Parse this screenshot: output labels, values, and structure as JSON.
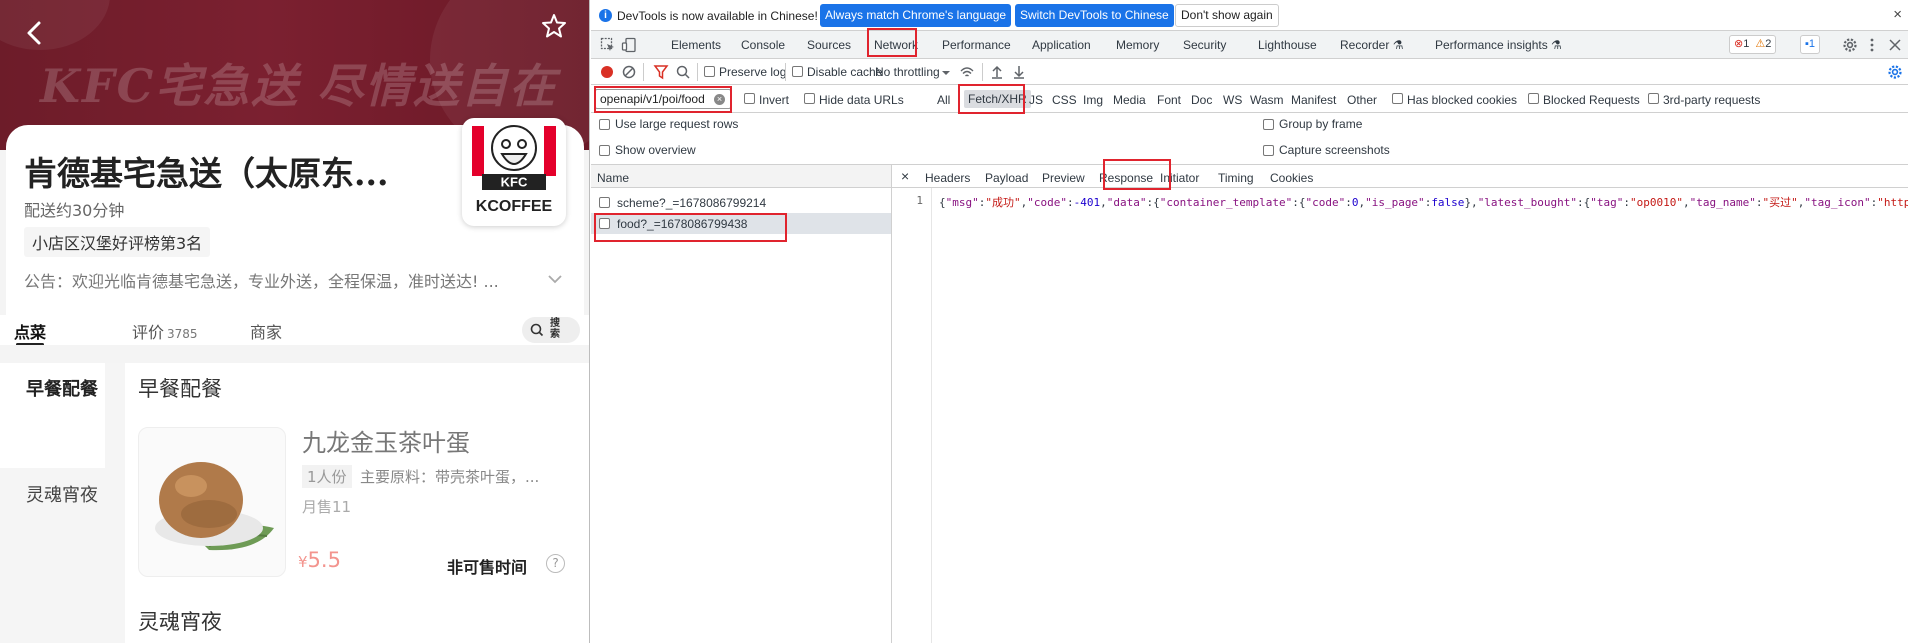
{
  "app": {
    "banner_text": "KFC宅急送 尽情送自在",
    "shop_name": "肯德基宅急送（太原东...",
    "delivery_time": "配送约30分钟",
    "rank_badge": "小店区汉堡好评榜第3名",
    "notice": "公告：欢迎光临肯德基宅急送，专业外送，全程保温，准时送达! ...",
    "logo_top": "KFC",
    "logo_bottom": "KCOFFEE",
    "tabs": {
      "order": "点菜",
      "review": "评价",
      "review_count": "3785",
      "shop": "商家",
      "search": "搜索"
    },
    "categories": [
      "早餐配餐",
      "灵魂宵夜"
    ],
    "sections": [
      "早餐配餐",
      "灵魂宵夜"
    ],
    "item": {
      "name": "九龙金玉茶叶蛋",
      "portion": "1人份",
      "desc": "主要原料：带壳茶叶蛋，...",
      "sales": "月售11",
      "price_currency": "¥",
      "price": "5.5",
      "status": "非可售时间",
      "help": "?"
    }
  },
  "devtools": {
    "infobar": {
      "message": "DevTools is now available in Chinese!",
      "match_button": "Always match Chrome's language",
      "switch_button": "Switch DevTools to Chinese",
      "dismiss_button": "Don't show again",
      "close": "×"
    },
    "tabs": [
      "Elements",
      "Console",
      "Sources",
      "Network",
      "Performance",
      "Application",
      "Memory",
      "Security",
      "Lighthouse",
      "Recorder ⚗",
      "Performance insights ⚗"
    ],
    "badges": {
      "errors": "1",
      "warnings": "2",
      "messages": "1"
    },
    "toolbar": {
      "preserve_log": "Preserve log",
      "disable_cache": "Disable cache",
      "throttling": "No throttling"
    },
    "filter": {
      "value": "openapi/v1/poi/food",
      "invert": "Invert",
      "hide_data_urls": "Hide data URLs",
      "types": [
        "All",
        "Fetch/XHR",
        "JS",
        "CSS",
        "Img",
        "Media",
        "Font",
        "Doc",
        "WS",
        "Wasm",
        "Manifest",
        "Other"
      ],
      "has_blocked_cookies": "Has blocked cookies",
      "blocked_requests": "Blocked Requests",
      "third_party": "3rd-party requests"
    },
    "options": {
      "large_rows": "Use large request rows",
      "overview": "Show overview",
      "group_by_frame": "Group by frame",
      "capture_screenshots": "Capture screenshots"
    },
    "name_header": "Name",
    "requests": [
      "scheme?_=1678086799214",
      "food?_=1678086799438"
    ],
    "detail_tabs": [
      "Headers",
      "Payload",
      "Preview",
      "Response",
      "Initiator",
      "Timing",
      "Cookies"
    ],
    "response": {
      "line_number": "1",
      "msg_key": "\"msg\"",
      "msg_val": "\"成功\"",
      "code_key": "\"code\"",
      "code_val": "-401",
      "data_key": "\"data\"",
      "ct_key": "\"container_template\"",
      "ct_code_key": "\"code\"",
      "ct_code_val": "0",
      "is_page_key": "\"is_page\"",
      "is_page_val": "false",
      "lb_key": "\"latest_bought\"",
      "tag_key": "\"tag\"",
      "tag_val": "\"op0010\"",
      "tag_name_key": "\"tag_name\"",
      "tag_name_val": "\"买过\"",
      "tag_icon_key": "\"tag_icon\"",
      "tag_icon_val": "\"http"
    }
  }
}
